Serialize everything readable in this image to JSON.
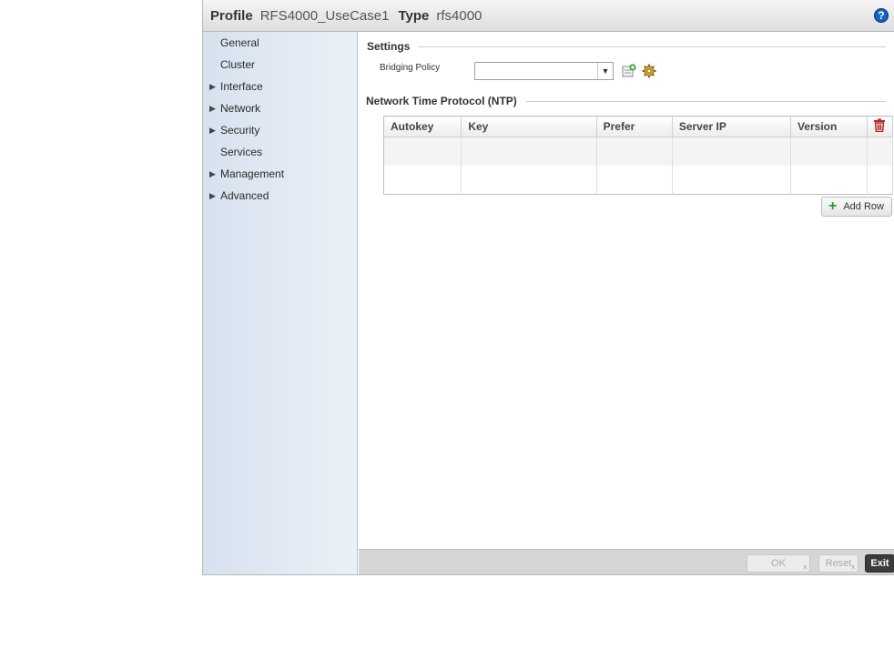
{
  "header": {
    "profile_label": "Profile",
    "profile_value": "RFS4000_UseCase1",
    "type_label": "Type",
    "type_value": "rfs4000",
    "help_icon": "help-icon",
    "help_glyph": "?"
  },
  "sidebar": {
    "items": [
      {
        "label": "General",
        "expandable": false
      },
      {
        "label": "Cluster",
        "expandable": false
      },
      {
        "label": "Interface",
        "expandable": true
      },
      {
        "label": "Network",
        "expandable": true
      },
      {
        "label": "Security",
        "expandable": true
      },
      {
        "label": "Services",
        "expandable": false
      },
      {
        "label": "Management",
        "expandable": true
      },
      {
        "label": "Advanced",
        "expandable": true
      }
    ],
    "arrow_glyph": "▶"
  },
  "settings": {
    "title": "Settings",
    "bridging_policy_label": "Bridging Policy",
    "bridging_policy_value": ""
  },
  "ntp": {
    "title": "Network Time Protocol (NTP)",
    "columns": [
      "Autokey",
      "Key",
      "Prefer",
      "Server IP",
      "Version"
    ],
    "rows": [
      [
        "",
        "",
        "",
        "",
        ""
      ],
      [
        "",
        "",
        "",
        "",
        ""
      ]
    ],
    "add_row_label": "Add Row"
  },
  "footer": {
    "ok_label": "OK",
    "reset_label": "Reset",
    "exit_label": "Exit",
    "sub_mark": "x"
  },
  "colors": {
    "help": "#1565c0",
    "add_green": "#2f9a2f",
    "delete_red": "#b52a2a",
    "exit_bg": "#3b3b3b"
  }
}
